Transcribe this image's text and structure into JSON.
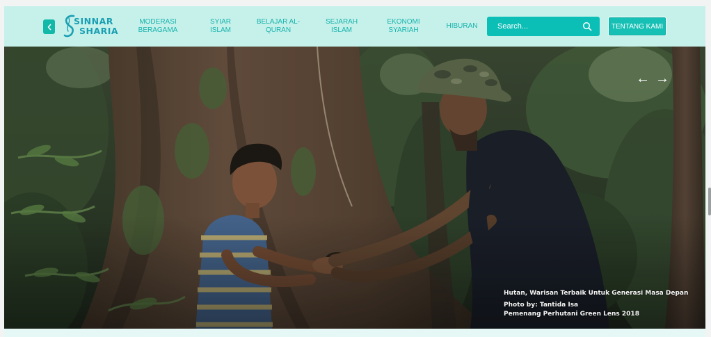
{
  "brand": {
    "line1": "SINNAR",
    "line2": "SHARIA"
  },
  "nav": {
    "items": [
      {
        "label": "MODERASI BERAGAMA"
      },
      {
        "label": "SYIAR ISLAM"
      },
      {
        "label": "BELAJAR AL-QURAN"
      },
      {
        "label": "SEJARAH ISLAM"
      },
      {
        "label": "EKONOMI SYARIAH"
      },
      {
        "label": "HIBURAN"
      }
    ]
  },
  "search": {
    "placeholder": "Search..."
  },
  "about_label": "TENTANG KAMI",
  "hero": {
    "caption_title": "Hutan, Warisan Terbaik Untuk Generasi Masa Depan",
    "caption_credit": "Photo by: Tantida Isa",
    "caption_award": "Pemenang Perhutani Green Lens 2018"
  },
  "colors": {
    "navbar_bg": "#c6f1ea",
    "accent": "#0bbfb6",
    "nav_text": "#16b2ad"
  },
  "icons": {
    "back": "chevron-left-icon",
    "search": "search-icon",
    "prev": "arrow-left-icon",
    "next": "arrow-right-icon"
  }
}
